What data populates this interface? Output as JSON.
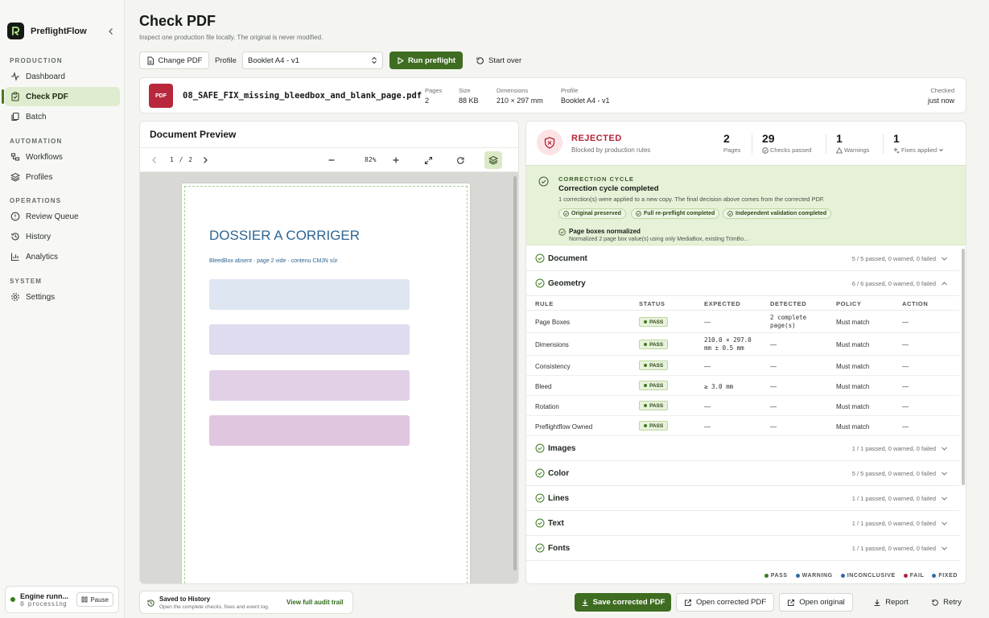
{
  "app": {
    "name": "PreflightFlow"
  },
  "sidebar": {
    "sections": [
      {
        "title": "PRODUCTION",
        "items": [
          {
            "label": "Dashboard"
          },
          {
            "label": "Check PDF",
            "active": true
          },
          {
            "label": "Batch"
          }
        ]
      },
      {
        "title": "AUTOMATION",
        "items": [
          {
            "label": "Workflows"
          },
          {
            "label": "Profiles"
          }
        ]
      },
      {
        "title": "OPERATIONS",
        "items": [
          {
            "label": "Review Queue"
          },
          {
            "label": "History"
          },
          {
            "label": "Analytics"
          }
        ]
      },
      {
        "title": "SYSTEM",
        "items": [
          {
            "label": "Settings"
          }
        ]
      }
    ],
    "engine": {
      "title": "Engine runn...",
      "subtitle": "0 processing",
      "pause_label": "Pause"
    }
  },
  "header": {
    "title": "Check PDF",
    "subtitle": "Inspect one production file locally. The original is never modified.",
    "change_pdf_label": "Change PDF",
    "profile_label": "Profile",
    "profile_value": "Booklet A4 - v1",
    "run_label": "Run preflight",
    "start_over_label": "Start over"
  },
  "file": {
    "badge": "PDF",
    "name": "08_SAFE_FIX_missing_bleedbox_and_blank_page.pdf",
    "meta": [
      {
        "label": "Pages",
        "value": "2"
      },
      {
        "label": "Size",
        "value": "88 KB"
      },
      {
        "label": "Dimensions",
        "value": "210 × 297 mm"
      },
      {
        "label": "Profile",
        "value": "Booklet A4 - v1"
      }
    ],
    "checked_label": "Checked",
    "checked_value": "just now"
  },
  "preview": {
    "title": "Document Preview",
    "page_indicator": "1 / 2",
    "zoom": "82%",
    "page": {
      "heading": "DOSSIER A CORRIGER",
      "subheading": "BleedBox absent · page 2 vide · contenu CMJN sûr",
      "block_colors": [
        "#dee6f2",
        "#dedcee",
        "#e2d1e6",
        "#e0c6df"
      ]
    }
  },
  "result": {
    "verdict": "REJECTED",
    "verdict_sub": "Blocked by production rules",
    "stats": [
      {
        "value": "2",
        "label": "Pages"
      },
      {
        "value": "29",
        "label": "Checks passed"
      },
      {
        "value": "1",
        "label": "Warnings"
      },
      {
        "value": "1",
        "label": "Fixes applied"
      }
    ],
    "correction": {
      "kicker": "CORRECTION CYCLE",
      "title": "Correction cycle completed",
      "desc": "1 correction(s) were applied to a new copy. The final decision above comes from the corrected PDF.",
      "chips": [
        "Original preserved",
        "Full re-preflight completed",
        "Independent validation completed"
      ],
      "fix_title": "Page boxes normalized",
      "fix_desc": "Normalized 2 page box value(s) using only MediaBox, existing TrimBo..."
    },
    "groups": [
      {
        "name": "Document",
        "summary": "5 / 5 passed, 0 warned, 0 failed"
      },
      {
        "name": "Geometry",
        "summary": "6 / 6 passed, 0 warned, 0 failed"
      },
      {
        "name": "Images",
        "summary": "1 / 1 passed, 0 warned, 0 failed"
      },
      {
        "name": "Color",
        "summary": "5 / 5 passed, 0 warned, 0 failed"
      },
      {
        "name": "Lines",
        "summary": "1 / 1 passed, 0 warned, 0 failed"
      },
      {
        "name": "Text",
        "summary": "1 / 1 passed, 0 warned, 0 failed"
      },
      {
        "name": "Fonts",
        "summary": "1 / 1 passed, 0 warned, 0 failed"
      }
    ],
    "geometry_table": {
      "columns": [
        "RULE",
        "STATUS",
        "EXPECTED",
        "DETECTED",
        "POLICY",
        "ACTION"
      ],
      "rows": [
        {
          "rule": "Page Boxes",
          "status": "PASS",
          "expected": "—",
          "detected": "2 complete page(s)",
          "policy": "Must match",
          "action": "—"
        },
        {
          "rule": "Dimensions",
          "status": "PASS",
          "expected": "210.0 × 297.0 mm ± 0.5 mm",
          "detected": "—",
          "policy": "Must match",
          "action": "—"
        },
        {
          "rule": "Consistency",
          "status": "PASS",
          "expected": "—",
          "detected": "—",
          "policy": "Must match",
          "action": "—"
        },
        {
          "rule": "Bleed",
          "status": "PASS",
          "expected": "≥ 3.0 mm",
          "detected": "—",
          "policy": "Must match",
          "action": "—"
        },
        {
          "rule": "Rotation",
          "status": "PASS",
          "expected": "—",
          "detected": "—",
          "policy": "Must match",
          "action": "—"
        },
        {
          "rule": "Preflightflow Owned",
          "status": "PASS",
          "expected": "—",
          "detected": "—",
          "policy": "Must match",
          "action": "—"
        }
      ]
    },
    "legend": [
      {
        "label": "PASS",
        "color": "#3d7a1d"
      },
      {
        "label": "WARNING",
        "color": "#2f6aa3"
      },
      {
        "label": "INCONCLUSIVE",
        "color": "#2f6aa3"
      },
      {
        "label": "FAIL",
        "color": "#b42336"
      },
      {
        "label": "FIXED",
        "color": "#2f6aa3"
      }
    ]
  },
  "footer": {
    "saved_title": "Saved to History",
    "saved_sub": "Open the complete checks, fixes and event log.",
    "audit_link": "View full audit trail",
    "buttons": {
      "save_corrected": "Save corrected PDF",
      "open_corrected": "Open corrected PDF",
      "open_original": "Open original",
      "report": "Report",
      "retry": "Retry"
    }
  },
  "colors": {
    "accent": "#3e6c20",
    "rejected": "#b42336",
    "pdf_badge": "#b8273c"
  }
}
